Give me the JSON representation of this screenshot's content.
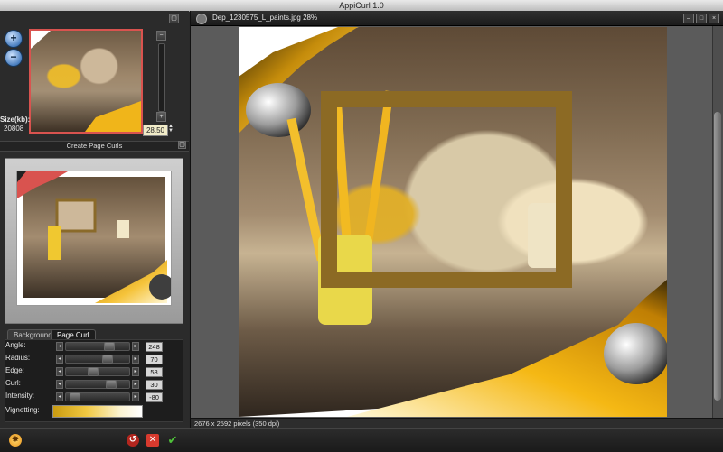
{
  "app": {
    "title": "AppiCurl 1.0"
  },
  "navigator": {
    "size_label": "Size(kb):",
    "size_value": "20808",
    "zoom_value": "28.50"
  },
  "create_curls": {
    "header": "Create Page Curls"
  },
  "tabs": [
    {
      "label": "Background"
    },
    {
      "label": "Page Curl"
    }
  ],
  "controls": [
    {
      "label": "Angle:",
      "value": "248"
    },
    {
      "label": "Radius:",
      "value": "70"
    },
    {
      "label": "Edge:",
      "value": "58"
    },
    {
      "label": "Curl:",
      "value": "30"
    },
    {
      "label": "Intensity:",
      "value": "-80"
    }
  ],
  "vignetting": {
    "label": "Vignetting:"
  },
  "document": {
    "title": "Dep_1230575_L_paints.jpg 28%",
    "status": "2676 x 2592 pixels (350 dpi)"
  },
  "colors": {
    "accent_red": "#d9534f",
    "curl_yellow": "#f0b51a"
  }
}
